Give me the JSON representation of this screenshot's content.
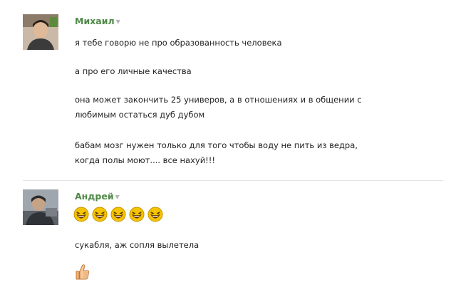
{
  "messages": [
    {
      "author": "Михаил",
      "avatar_icon": "user-photo-icon",
      "lines": [
        "я тебе говорю не про образованность человека",
        "а про его личные качества",
        "она может закончить 25 универов, а в отношениях и в общении с",
        "любимым остаться дуб дубом",
        "бабам мозг нужен только для того чтобы воду не пить из ведра,",
        "когда полы моют.... все нахуй!!!"
      ]
    },
    {
      "author": "Андрей",
      "avatar_icon": "user-photo-icon",
      "emoji_icon": "laughing-smiley-icon",
      "emoji_count": 5,
      "lines": [
        "сукабля, аж сопля вылетела"
      ],
      "like_icon": "thumbs-up-icon"
    }
  ],
  "colors": {
    "author": "#4f8a47",
    "text": "#222222",
    "emoji": "#f5c400"
  }
}
